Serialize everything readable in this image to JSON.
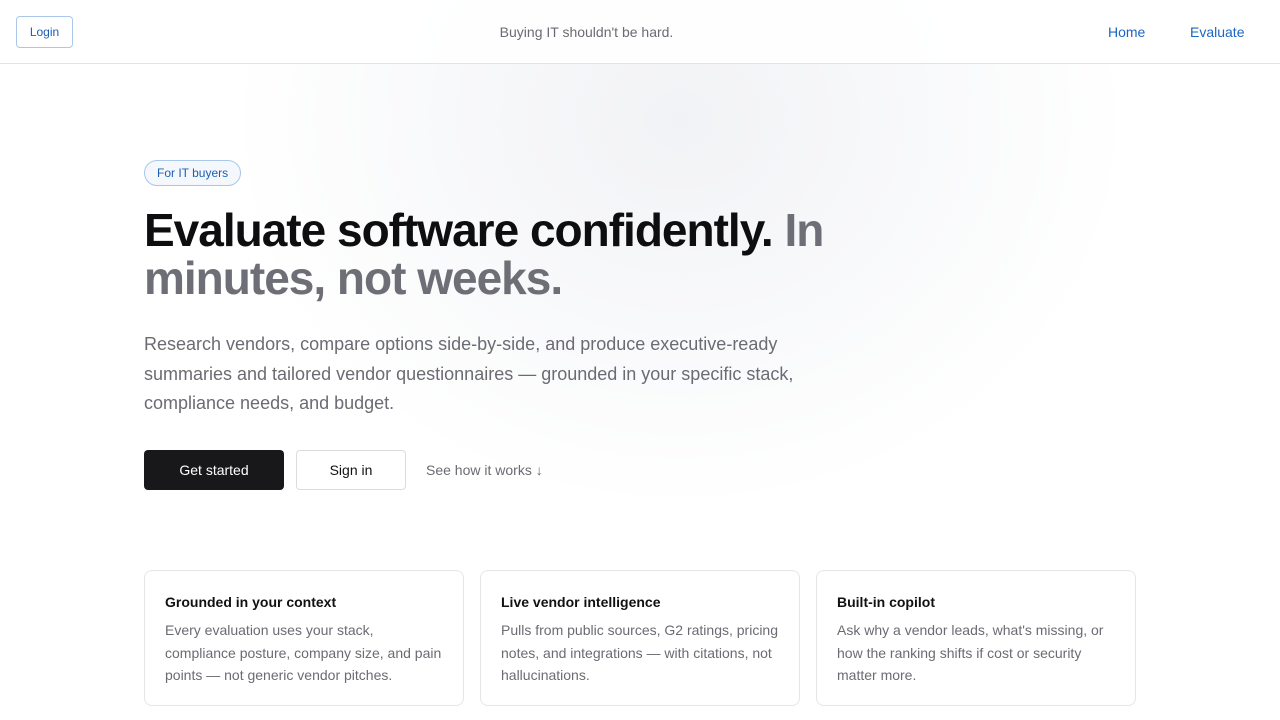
{
  "header": {
    "login_label": "Login",
    "tagline": "Buying IT shouldn't be hard.",
    "nav": [
      {
        "label": "Home"
      },
      {
        "label": "Evaluate"
      }
    ]
  },
  "hero": {
    "badge": "For IT buyers",
    "title_main": "Evaluate software confidently.",
    "title_muted": "In minutes, not weeks.",
    "lead": "Research vendors, compare options side-by-side, and produce executive-ready summaries and tailored vendor questionnaires — grounded in your specific stack, compliance needs, and budget.",
    "cta_primary": "Get started",
    "cta_secondary": "Sign in",
    "cta_link": "See how it works ↓"
  },
  "features": [
    {
      "title": "Grounded in your context",
      "body": "Every evaluation uses your stack, compliance posture, company size, and pain points — not generic vendor pitches."
    },
    {
      "title": "Live vendor intelligence",
      "body": "Pulls from public sources, G2 ratings, pricing notes, and integrations — with citations, not hallucinations."
    },
    {
      "title": "Built-in copilot",
      "body": "Ask why a vendor leads, what's missing, or how the ranking shifts if cost or security matter more."
    }
  ],
  "colors": {
    "accent": "#1a66c2",
    "primary_button": "#18181b",
    "muted_text": "#6b6b73",
    "header_border": "#d6e6f5"
  }
}
